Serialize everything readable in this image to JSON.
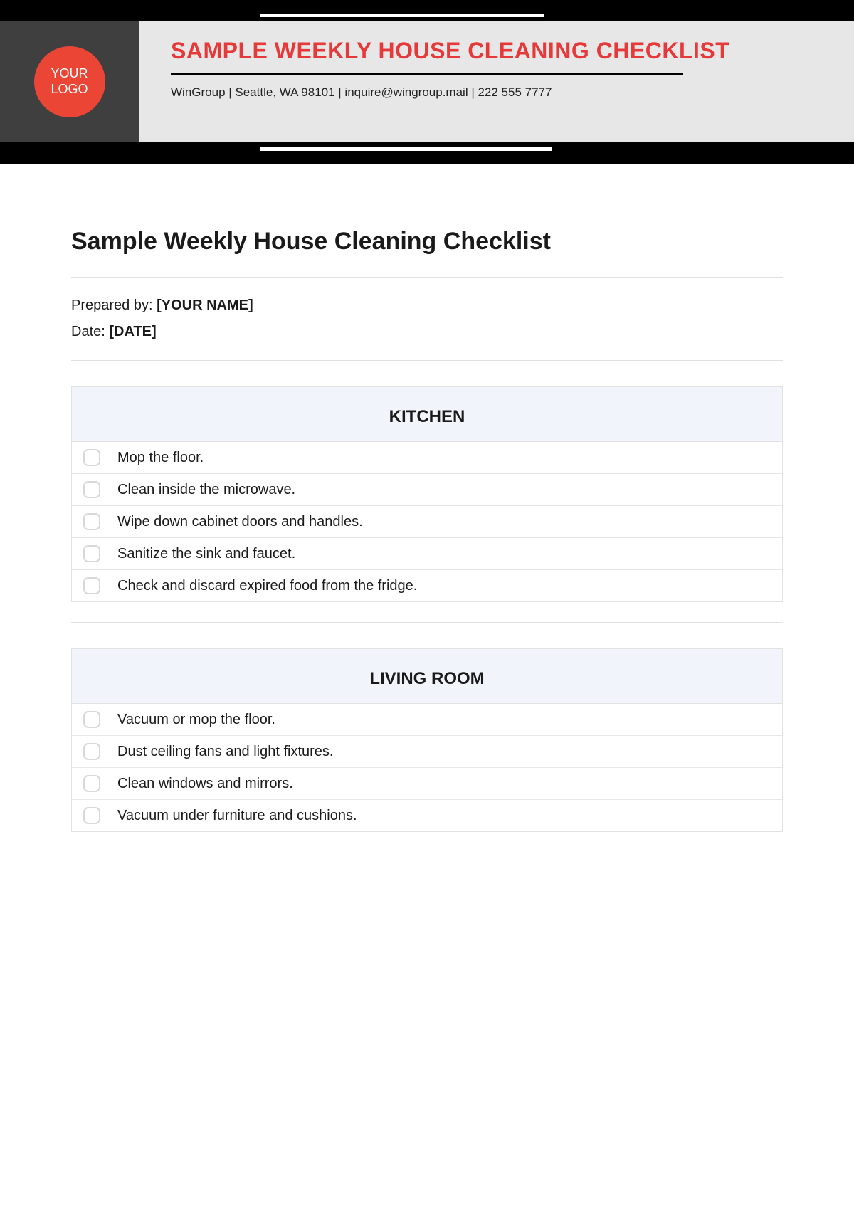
{
  "header": {
    "logo_text1": "YOUR",
    "logo_text2": "LOGO",
    "title": "SAMPLE WEEKLY HOUSE CLEANING CHECKLIST",
    "contact": "WinGroup | Seattle, WA 98101 | inquire@wingroup.mail | 222 555 7777"
  },
  "main": {
    "title": "Sample Weekly House Cleaning Checklist",
    "prepared_label": "Prepared by: ",
    "prepared_value": "[YOUR NAME]",
    "date_label": "Date: ",
    "date_value": "[DATE]"
  },
  "sections": [
    {
      "title": "KITCHEN",
      "tasks": [
        "Mop the floor.",
        "Clean inside the microwave.",
        "Wipe down cabinet doors and handles.",
        "Sanitize the sink and faucet.",
        "Check and discard expired food from the fridge."
      ]
    },
    {
      "title": "LIVING ROOM",
      "tasks": [
        "Vacuum or mop the floor.",
        "Dust ceiling fans and light fixtures.",
        "Clean windows and mirrors.",
        "Vacuum under furniture and cushions."
      ]
    }
  ]
}
